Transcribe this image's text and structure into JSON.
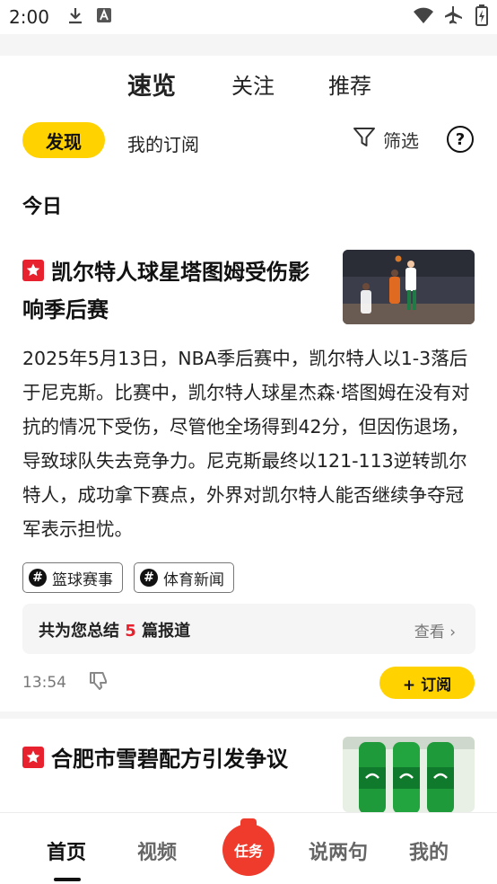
{
  "status_bar": {
    "time": "2:00",
    "left_icons": [
      "download-icon",
      "keyboard-a-icon"
    ],
    "right_icons": [
      "wifi-icon",
      "airplane-icon",
      "battery-charging-icon"
    ]
  },
  "top_tabs": [
    {
      "label": "速览",
      "active": true
    },
    {
      "label": "关注",
      "active": false
    },
    {
      "label": "推荐",
      "active": false
    }
  ],
  "filter_row": {
    "discover_label": "发现",
    "subscriptions_label": "我的订阅",
    "filter_label": "筛选",
    "help_label": "?"
  },
  "section_title": "今日",
  "articles": [
    {
      "title": "凯尔特人球星塔图姆受伤影响季后赛",
      "summary": "2025年5月13日，NBA季后赛中，凯尔特人以1-3落后于尼克斯。比赛中，凯尔特人球星杰森·塔图姆在没有对抗的情况下受伤，尽管他全场得到42分，但因伤退场，导致球队失去竞争力。尼克斯最终以121-113逆转凯尔特人，成功拿下赛点，外界对凯尔特人能否继续争夺冠军表示担忧。",
      "tags": [
        "篮球赛事",
        "体育新闻"
      ],
      "digest_prefix": "共为您总结",
      "digest_count": "5",
      "digest_suffix": "篇报道",
      "view_label": "查看",
      "time": "13:54",
      "subscribe_label": "+ 订阅"
    },
    {
      "title": "合肥市雪碧配方引发争议"
    }
  ],
  "bottom_nav": [
    {
      "label": "首页",
      "active": true
    },
    {
      "label": "视频",
      "active": false
    },
    {
      "label": "任务",
      "active": false
    },
    {
      "label": "说两句",
      "active": false
    },
    {
      "label": "我的",
      "active": false
    }
  ],
  "colors": {
    "accent_yellow": "#ffd200",
    "hot_red": "#e8212e",
    "task_red": "#ef3b2c"
  }
}
